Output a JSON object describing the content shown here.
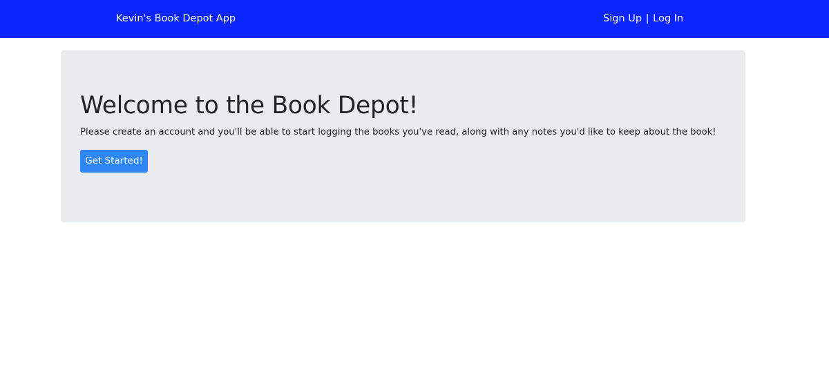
{
  "navbar": {
    "brand": "Kevin's Book Depot App",
    "links": {
      "sign_up": "Sign Up",
      "separator": "|",
      "log_in": "Log In"
    },
    "background_color": "#0a25ff"
  },
  "hero": {
    "title": "Welcome to the Book Depot!",
    "lead": "Please create an account and you'll be able to start logging the books you've read, along with any notes you'd like to keep about the book!",
    "cta_label": "Get Started!",
    "cta_color": "#2f86f6",
    "background_color": "#e9ecef"
  }
}
